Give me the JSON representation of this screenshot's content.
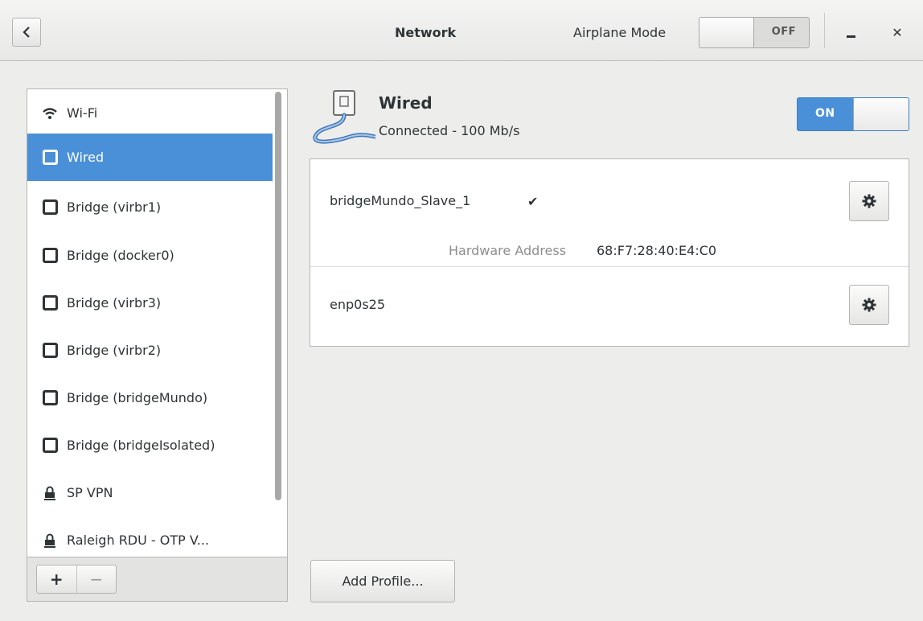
{
  "header": {
    "title": "Network",
    "airplane_mode_label": "Airplane Mode",
    "airplane_mode_state": "OFF"
  },
  "sidebar": {
    "items": [
      {
        "label": "Wi-Fi",
        "icon": "wifi-icon"
      },
      {
        "label": "Wired",
        "icon": "network-device-icon",
        "selected": true
      },
      {
        "label": "Bridge (virbr1)",
        "icon": "network-device-icon"
      },
      {
        "label": "Bridge (docker0)",
        "icon": "network-device-icon"
      },
      {
        "label": "Bridge (virbr3)",
        "icon": "network-device-icon"
      },
      {
        "label": "Bridge (virbr2)",
        "icon": "network-device-icon"
      },
      {
        "label": "Bridge (bridgeMundo)",
        "icon": "network-device-icon"
      },
      {
        "label": "Bridge (bridgeIsolated)",
        "icon": "network-device-icon"
      },
      {
        "label": "SP VPN",
        "icon": "vpn-lock-icon"
      },
      {
        "label": "Raleigh RDU - OTP V...",
        "icon": "vpn-lock-icon"
      }
    ],
    "add_label": "+",
    "remove_label": "−"
  },
  "device": {
    "name": "Wired",
    "status": "Connected - 100 Mb/s",
    "switch_state": "ON"
  },
  "profiles": [
    {
      "name": "bridgeMundo_Slave_1",
      "active_mark": "✔",
      "hardware_address_label": "Hardware Address",
      "hardware_address": "68:F7:28:40:E4:C0"
    },
    {
      "name": "enp0s25"
    }
  ],
  "add_profile_label": "Add Profile...",
  "colors": {
    "accent": "#4a90d9",
    "background": "#ededec"
  }
}
